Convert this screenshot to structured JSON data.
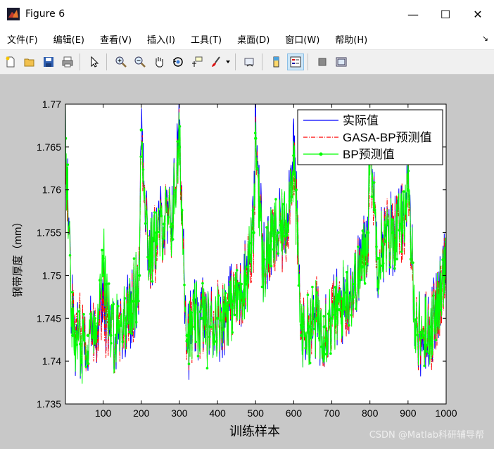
{
  "window": {
    "title": "Figure 6",
    "minimize": "—",
    "maximize": "☐",
    "close": "✕"
  },
  "menu": [
    "文件(F)",
    "编辑(E)",
    "查看(V)",
    "插入(I)",
    "工具(T)",
    "桌面(D)",
    "窗口(W)",
    "帮助(H)"
  ],
  "toolbar_icons": [
    "new-figure-icon",
    "open-file-icon",
    "save-icon",
    "print-icon",
    "pointer-icon",
    "zoom-in-icon",
    "zoom-out-icon",
    "pan-hand-icon",
    "rotate-3d-icon",
    "data-cursor-icon",
    "brush-icon",
    "link-plot-icon",
    "colorbar-icon",
    "legend-icon",
    "hide-plot-tools-icon",
    "show-plot-tools-icon"
  ],
  "chart_data": {
    "type": "line",
    "title": "",
    "xlabel": "训练样本",
    "ylabel": "钢带厚度（mm）",
    "xlim": [
      1,
      1000
    ],
    "ylim": [
      1.735,
      1.77
    ],
    "xticks": [
      100,
      200,
      300,
      400,
      500,
      600,
      700,
      800,
      900,
      1000
    ],
    "yticks": [
      1.735,
      1.74,
      1.745,
      1.75,
      1.755,
      1.76,
      1.765,
      1.77
    ],
    "ytick_labels": [
      "1.735",
      "1.74",
      "1.745",
      "1.75",
      "1.755",
      "1.76",
      "1.765",
      "1.77"
    ],
    "legend_position": "top-right",
    "grid": false,
    "series": [
      {
        "name": "实际值",
        "color": "#0000ff",
        "style": "solid",
        "x": [
          1,
          20,
          40,
          60,
          80,
          100,
          120,
          140,
          160,
          180,
          195,
          200,
          220,
          240,
          260,
          280,
          300,
          320,
          340,
          360,
          380,
          400,
          420,
          440,
          460,
          480,
          495,
          500,
          520,
          540,
          560,
          580,
          600,
          620,
          640,
          660,
          680,
          700,
          720,
          740,
          760,
          780,
          795,
          800,
          820,
          840,
          860,
          880,
          900,
          920,
          940,
          960,
          980,
          1000
        ],
        "y": [
          1.766,
          1.744,
          1.742,
          1.743,
          1.744,
          1.748,
          1.743,
          1.744,
          1.745,
          1.747,
          1.75,
          1.769,
          1.752,
          1.755,
          1.756,
          1.757,
          1.766,
          1.743,
          1.744,
          1.745,
          1.744,
          1.745,
          1.746,
          1.747,
          1.748,
          1.752,
          1.755,
          1.768,
          1.751,
          1.754,
          1.755,
          1.756,
          1.766,
          1.743,
          1.744,
          1.745,
          1.744,
          1.745,
          1.746,
          1.748,
          1.749,
          1.752,
          1.755,
          1.768,
          1.752,
          1.754,
          1.755,
          1.756,
          1.76,
          1.744,
          1.743,
          1.744,
          1.746,
          1.753
        ]
      },
      {
        "name": "GASA-BP预测值",
        "color": "#ff0000",
        "style": "dashdot",
        "x": [
          1,
          20,
          40,
          60,
          80,
          100,
          120,
          140,
          160,
          180,
          195,
          200,
          220,
          240,
          260,
          280,
          300,
          320,
          340,
          360,
          380,
          400,
          420,
          440,
          460,
          480,
          495,
          500,
          520,
          540,
          560,
          580,
          600,
          620,
          640,
          660,
          680,
          700,
          720,
          740,
          760,
          780,
          795,
          800,
          820,
          840,
          860,
          880,
          900,
          920,
          940,
          960,
          980,
          1000
        ],
        "y": [
          1.765,
          1.744,
          1.743,
          1.743,
          1.744,
          1.747,
          1.743,
          1.744,
          1.745,
          1.747,
          1.75,
          1.767,
          1.752,
          1.754,
          1.756,
          1.756,
          1.765,
          1.743,
          1.744,
          1.745,
          1.744,
          1.745,
          1.746,
          1.747,
          1.748,
          1.751,
          1.754,
          1.766,
          1.751,
          1.754,
          1.755,
          1.755,
          1.764,
          1.743,
          1.744,
          1.745,
          1.744,
          1.745,
          1.746,
          1.747,
          1.749,
          1.751,
          1.754,
          1.766,
          1.752,
          1.754,
          1.755,
          1.755,
          1.759,
          1.744,
          1.743,
          1.744,
          1.746,
          1.752
        ]
      },
      {
        "name": "BP预测值",
        "color": "#00ff00",
        "style": "solid-marker",
        "x": [
          1,
          20,
          40,
          60,
          80,
          100,
          120,
          140,
          160,
          180,
          195,
          200,
          220,
          240,
          260,
          280,
          300,
          320,
          340,
          360,
          380,
          400,
          420,
          440,
          460,
          480,
          495,
          500,
          520,
          540,
          560,
          580,
          600,
          620,
          640,
          660,
          680,
          700,
          720,
          740,
          760,
          780,
          795,
          800,
          820,
          840,
          860,
          880,
          900,
          920,
          940,
          960,
          980,
          1000
        ],
        "y": [
          1.766,
          1.743,
          1.742,
          1.743,
          1.744,
          1.752,
          1.743,
          1.744,
          1.745,
          1.747,
          1.75,
          1.767,
          1.752,
          1.755,
          1.756,
          1.756,
          1.765,
          1.743,
          1.744,
          1.745,
          1.744,
          1.745,
          1.746,
          1.747,
          1.748,
          1.751,
          1.755,
          1.766,
          1.751,
          1.754,
          1.755,
          1.756,
          1.764,
          1.743,
          1.744,
          1.745,
          1.744,
          1.745,
          1.746,
          1.748,
          1.749,
          1.751,
          1.755,
          1.766,
          1.752,
          1.754,
          1.755,
          1.756,
          1.76,
          1.744,
          1.743,
          1.744,
          1.746,
          1.753
        ]
      }
    ]
  },
  "watermark": "CSDN @Matlab科研辅导帮"
}
